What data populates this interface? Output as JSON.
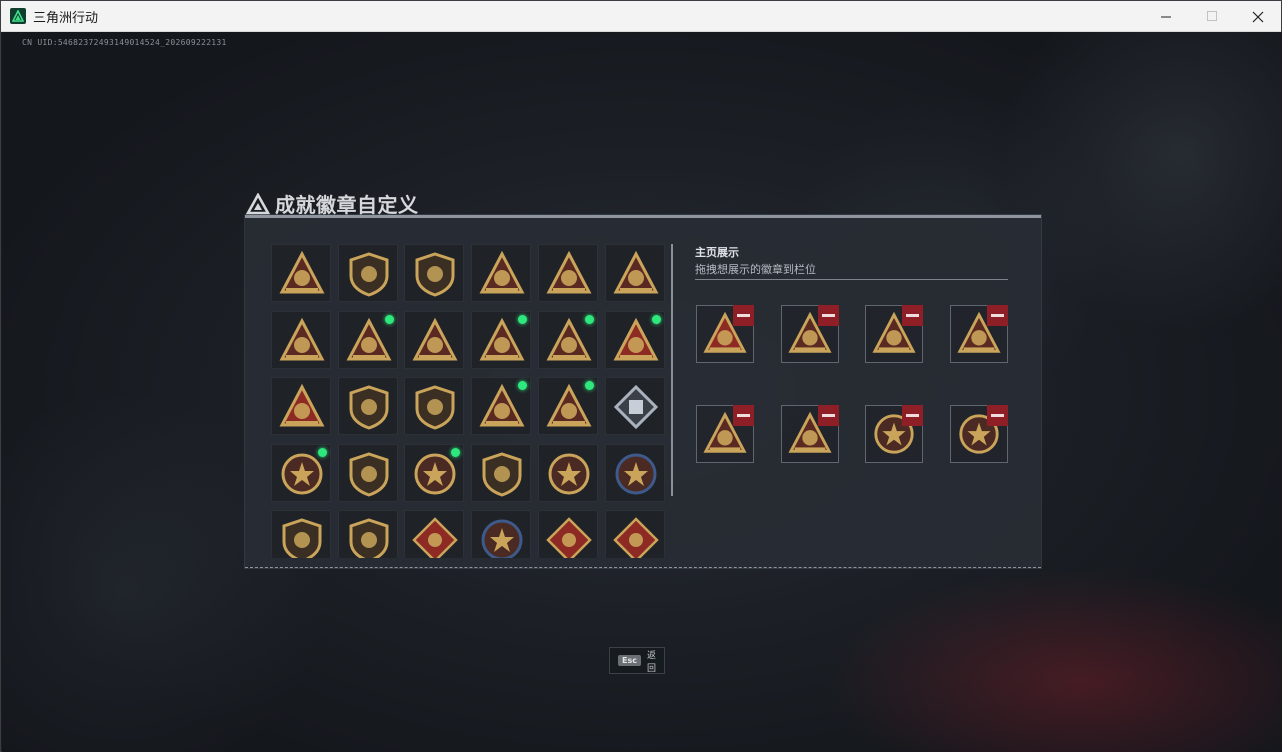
{
  "window": {
    "title": "三角洲行动",
    "buttons": [
      "minimize",
      "maximize",
      "close"
    ]
  },
  "uid_text": "CN UID:546823724931490145­24_202609222131",
  "heading": "成就徽章自定义",
  "badges": [
    {
      "icon": "triangle-shield-badge",
      "new": false
    },
    {
      "icon": "helicopter-badge",
      "new": false
    },
    {
      "icon": "diamond-emblem-badge",
      "new": false
    },
    {
      "icon": "envelope-badge",
      "new": false
    },
    {
      "icon": "backpack-badge",
      "new": false
    },
    {
      "icon": "number-56-badge",
      "new": false
    },
    {
      "icon": "cabinet-badge",
      "new": false
    },
    {
      "icon": "number-58-badge",
      "new": true
    },
    {
      "icon": "building-badge",
      "new": false
    },
    {
      "icon": "gold-coins-badge",
      "new": true
    },
    {
      "icon": "helmet-badge",
      "new": true
    },
    {
      "icon": "number-1-badge",
      "new": true
    },
    {
      "icon": "number-2-badge",
      "new": false
    },
    {
      "icon": "fist-badge",
      "new": false
    },
    {
      "icon": "crest-badge",
      "new": false
    },
    {
      "icon": "eagle-triangle-badge",
      "new": true
    },
    {
      "icon": "soldiers-badge",
      "new": true
    },
    {
      "icon": "silver-cube-badge",
      "new": false
    },
    {
      "icon": "star-medal-badge",
      "new": true
    },
    {
      "icon": "wing-shield-badge",
      "new": false
    },
    {
      "icon": "crowned-medal-badge",
      "new": true
    },
    {
      "icon": "lion-shield-badge",
      "new": false
    },
    {
      "icon": "skull-round-badge",
      "new": false
    },
    {
      "icon": "blue-skull-badge",
      "new": false
    },
    {
      "icon": "rifle-shield-badge",
      "new": false
    },
    {
      "icon": "knife-shield-badge",
      "new": false
    },
    {
      "icon": "cross-arms-badge",
      "new": false
    },
    {
      "icon": "wolf-round-badge",
      "new": false
    },
    {
      "icon": "dragon-badge",
      "new": false
    },
    {
      "icon": "hammer-badge",
      "new": false
    }
  ],
  "showcase": {
    "title": "主页展示",
    "subtitle": "拖拽想展示的徽章到栏位",
    "slots": [
      {
        "icon": "number-1-badge"
      },
      {
        "icon": "helmet-badge"
      },
      {
        "icon": "number-58-badge"
      },
      {
        "icon": "gold-coins-badge"
      },
      {
        "icon": "soldiers-badge"
      },
      {
        "icon": "eagle-triangle-badge"
      },
      {
        "icon": "star-medal-badge"
      },
      {
        "icon": "crowned-medal-badge"
      }
    ]
  },
  "footer": {
    "esc_key": "Esc",
    "esc_label": "返回"
  },
  "colors": {
    "badge_gold": "#c9a45a",
    "badge_red": "#8e2a24",
    "new_dot": "#2ee87d",
    "remove_red": "#8e1f26"
  }
}
